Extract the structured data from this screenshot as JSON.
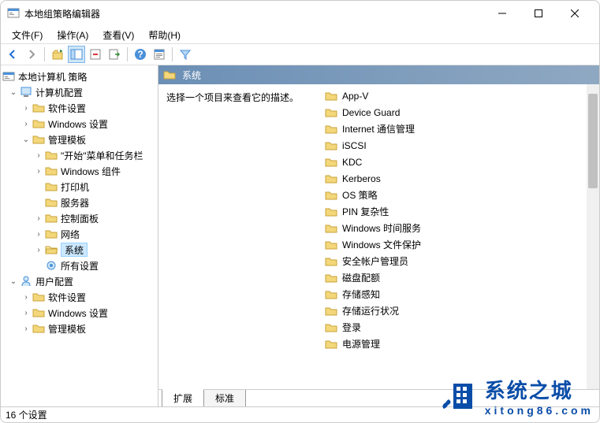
{
  "window": {
    "title": "本地组策略编辑器"
  },
  "menubar": {
    "file": "文件(F)",
    "action": "操作(A)",
    "view": "查看(V)",
    "help": "帮助(H)"
  },
  "tree": {
    "root": "本地计算机 策略",
    "computer_config": "计算机配置",
    "software_settings": "软件设置",
    "windows_settings": "Windows 设置",
    "admin_templates": "管理模板",
    "start_menu": "\"开始\"菜单和任务栏",
    "windows_components": "Windows 组件",
    "printers": "打印机",
    "server": "服务器",
    "control_panel": "控制面板",
    "network": "网络",
    "system": "系统",
    "all_settings": "所有设置",
    "user_config": "用户配置",
    "user_software": "软件设置",
    "user_windows": "Windows 设置",
    "user_admin": "管理模板"
  },
  "detail": {
    "header_title": "系统",
    "description": "选择一个项目来查看它的描述。",
    "items": [
      "App-V",
      "Device Guard",
      "Internet 通信管理",
      "iSCSI",
      "KDC",
      "Kerberos",
      "OS 策略",
      "PIN 复杂性",
      "Windows 时间服务",
      "Windows 文件保护",
      "安全帐户管理员",
      "磁盘配额",
      "存储感知",
      "存储运行状况",
      "登录",
      "电源管理"
    ]
  },
  "tabs": {
    "extended": "扩展",
    "standard": "标准"
  },
  "statusbar": {
    "text": "16 个设置"
  },
  "watermark": {
    "cn": "系统之城",
    "en": "xitong86.com"
  }
}
